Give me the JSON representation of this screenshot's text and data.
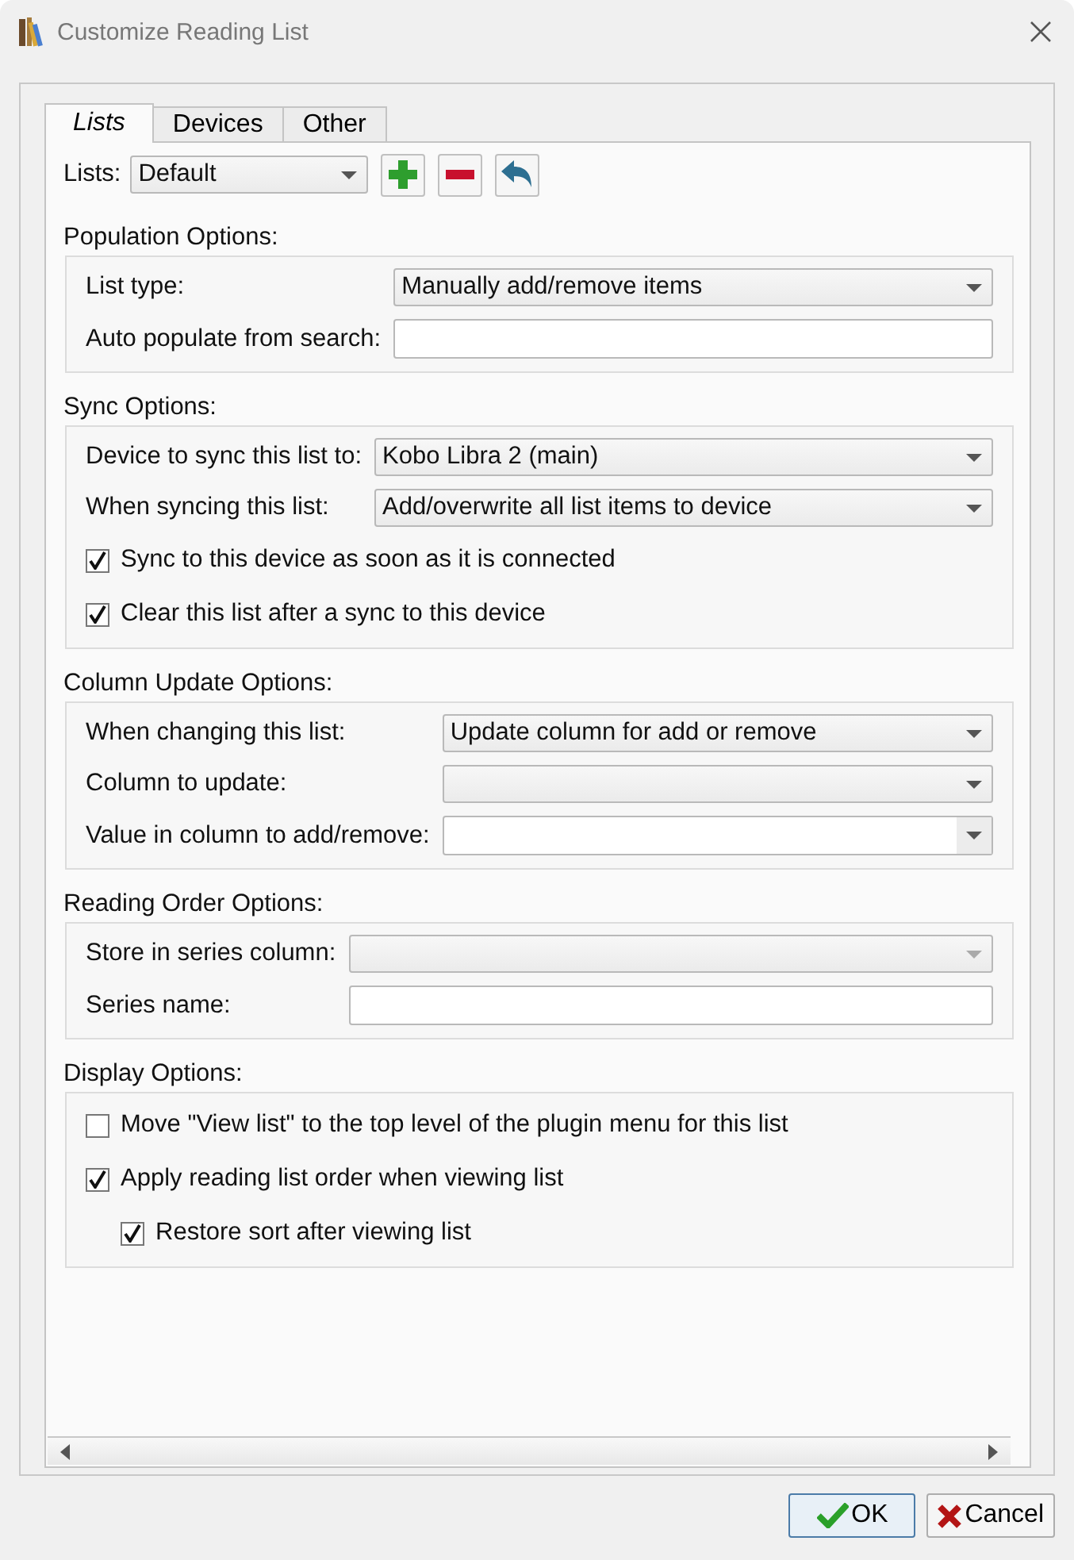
{
  "window": {
    "title": "Customize Reading List"
  },
  "tabs": [
    {
      "label": "Lists",
      "selected": true
    },
    {
      "label": "Devices",
      "selected": false
    },
    {
      "label": "Other",
      "selected": false
    }
  ],
  "lists_row": {
    "label": "Lists:",
    "value": "Default"
  },
  "sections": [
    {
      "heading": "Population Options:",
      "rows": [
        {
          "kind": "dropdown",
          "label": "List type:",
          "value": "Manually add/remove items",
          "disabled": false
        },
        {
          "kind": "text",
          "label": "Auto populate from search:"
        }
      ]
    },
    {
      "heading": "Sync Options:",
      "rows": [
        {
          "kind": "dropdown",
          "label": "Device to sync this list to:",
          "value": "Kobo Libra 2 (main)",
          "disabled": false
        },
        {
          "kind": "dropdown",
          "label": "When syncing this list:",
          "value": "Add/overwrite all list items to device",
          "disabled": false
        },
        {
          "kind": "checkbox",
          "label": "Sync to this device as soon as it is connected",
          "checked": true
        },
        {
          "kind": "checkbox",
          "label": "Clear this list after a sync to this device",
          "checked": true
        }
      ]
    },
    {
      "heading": "Column Update Options:",
      "rows": [
        {
          "kind": "dropdown",
          "label": "When changing this list:",
          "value": "Update column for add or remove",
          "disabled": false
        },
        {
          "kind": "dropdown",
          "label": "Column to update:",
          "disabled": false
        },
        {
          "kind": "combo",
          "label": "Value in column to add/remove:"
        }
      ]
    },
    {
      "heading": "Reading Order Options:",
      "rows": [
        {
          "kind": "dropdown",
          "label": "Store in series column:",
          "disabled": true
        },
        {
          "kind": "text",
          "label": "Series name:"
        }
      ]
    },
    {
      "heading": "Display Options:",
      "rows": [
        {
          "kind": "checkbox",
          "label": "Move \"View list\" to the top level of the plugin menu for this list",
          "checked": false
        },
        {
          "kind": "checkbox",
          "label": "Apply reading list order when viewing list",
          "checked": true,
          "children": [
            {
              "kind": "checkbox",
              "label": "Restore sort after viewing list",
              "checked": true
            }
          ]
        }
      ]
    }
  ],
  "buttons": [
    {
      "kind": "ok",
      "label": "OK"
    },
    {
      "kind": "cancel",
      "label": "Cancel"
    }
  ]
}
